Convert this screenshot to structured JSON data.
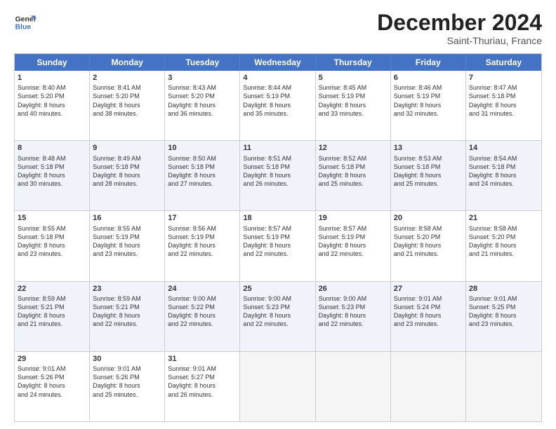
{
  "header": {
    "logo_line1": "General",
    "logo_line2": "Blue",
    "month": "December 2024",
    "location": "Saint-Thuriau, France"
  },
  "weekdays": [
    "Sunday",
    "Monday",
    "Tuesday",
    "Wednesday",
    "Thursday",
    "Friday",
    "Saturday"
  ],
  "rows": [
    [
      {
        "day": "1",
        "lines": [
          "Sunrise: 8:40 AM",
          "Sunset: 5:20 PM",
          "Daylight: 8 hours",
          "and 40 minutes."
        ]
      },
      {
        "day": "2",
        "lines": [
          "Sunrise: 8:41 AM",
          "Sunset: 5:20 PM",
          "Daylight: 8 hours",
          "and 38 minutes."
        ]
      },
      {
        "day": "3",
        "lines": [
          "Sunrise: 8:43 AM",
          "Sunset: 5:20 PM",
          "Daylight: 8 hours",
          "and 36 minutes."
        ]
      },
      {
        "day": "4",
        "lines": [
          "Sunrise: 8:44 AM",
          "Sunset: 5:19 PM",
          "Daylight: 8 hours",
          "and 35 minutes."
        ]
      },
      {
        "day": "5",
        "lines": [
          "Sunrise: 8:45 AM",
          "Sunset: 5:19 PM",
          "Daylight: 8 hours",
          "and 33 minutes."
        ]
      },
      {
        "day": "6",
        "lines": [
          "Sunrise: 8:46 AM",
          "Sunset: 5:19 PM",
          "Daylight: 8 hours",
          "and 32 minutes."
        ]
      },
      {
        "day": "7",
        "lines": [
          "Sunrise: 8:47 AM",
          "Sunset: 5:18 PM",
          "Daylight: 8 hours",
          "and 31 minutes."
        ]
      }
    ],
    [
      {
        "day": "8",
        "lines": [
          "Sunrise: 8:48 AM",
          "Sunset: 5:18 PM",
          "Daylight: 8 hours",
          "and 30 minutes."
        ]
      },
      {
        "day": "9",
        "lines": [
          "Sunrise: 8:49 AM",
          "Sunset: 5:18 PM",
          "Daylight: 8 hours",
          "and 28 minutes."
        ]
      },
      {
        "day": "10",
        "lines": [
          "Sunrise: 8:50 AM",
          "Sunset: 5:18 PM",
          "Daylight: 8 hours",
          "and 27 minutes."
        ]
      },
      {
        "day": "11",
        "lines": [
          "Sunrise: 8:51 AM",
          "Sunset: 5:18 PM",
          "Daylight: 8 hours",
          "and 26 minutes."
        ]
      },
      {
        "day": "12",
        "lines": [
          "Sunrise: 8:52 AM",
          "Sunset: 5:18 PM",
          "Daylight: 8 hours",
          "and 25 minutes."
        ]
      },
      {
        "day": "13",
        "lines": [
          "Sunrise: 8:53 AM",
          "Sunset: 5:18 PM",
          "Daylight: 8 hours",
          "and 25 minutes."
        ]
      },
      {
        "day": "14",
        "lines": [
          "Sunrise: 8:54 AM",
          "Sunset: 5:18 PM",
          "Daylight: 8 hours",
          "and 24 minutes."
        ]
      }
    ],
    [
      {
        "day": "15",
        "lines": [
          "Sunrise: 8:55 AM",
          "Sunset: 5:18 PM",
          "Daylight: 8 hours",
          "and 23 minutes."
        ]
      },
      {
        "day": "16",
        "lines": [
          "Sunrise: 8:55 AM",
          "Sunset: 5:19 PM",
          "Daylight: 8 hours",
          "and 23 minutes."
        ]
      },
      {
        "day": "17",
        "lines": [
          "Sunrise: 8:56 AM",
          "Sunset: 5:19 PM",
          "Daylight: 8 hours",
          "and 22 minutes."
        ]
      },
      {
        "day": "18",
        "lines": [
          "Sunrise: 8:57 AM",
          "Sunset: 5:19 PM",
          "Daylight: 8 hours",
          "and 22 minutes."
        ]
      },
      {
        "day": "19",
        "lines": [
          "Sunrise: 8:57 AM",
          "Sunset: 5:19 PM",
          "Daylight: 8 hours",
          "and 22 minutes."
        ]
      },
      {
        "day": "20",
        "lines": [
          "Sunrise: 8:58 AM",
          "Sunset: 5:20 PM",
          "Daylight: 8 hours",
          "and 21 minutes."
        ]
      },
      {
        "day": "21",
        "lines": [
          "Sunrise: 8:58 AM",
          "Sunset: 5:20 PM",
          "Daylight: 8 hours",
          "and 21 minutes."
        ]
      }
    ],
    [
      {
        "day": "22",
        "lines": [
          "Sunrise: 8:59 AM",
          "Sunset: 5:21 PM",
          "Daylight: 8 hours",
          "and 21 minutes."
        ]
      },
      {
        "day": "23",
        "lines": [
          "Sunrise: 8:59 AM",
          "Sunset: 5:21 PM",
          "Daylight: 8 hours",
          "and 22 minutes."
        ]
      },
      {
        "day": "24",
        "lines": [
          "Sunrise: 9:00 AM",
          "Sunset: 5:22 PM",
          "Daylight: 8 hours",
          "and 22 minutes."
        ]
      },
      {
        "day": "25",
        "lines": [
          "Sunrise: 9:00 AM",
          "Sunset: 5:23 PM",
          "Daylight: 8 hours",
          "and 22 minutes."
        ]
      },
      {
        "day": "26",
        "lines": [
          "Sunrise: 9:00 AM",
          "Sunset: 5:23 PM",
          "Daylight: 8 hours",
          "and 22 minutes."
        ]
      },
      {
        "day": "27",
        "lines": [
          "Sunrise: 9:01 AM",
          "Sunset: 5:24 PM",
          "Daylight: 8 hours",
          "and 23 minutes."
        ]
      },
      {
        "day": "28",
        "lines": [
          "Sunrise: 9:01 AM",
          "Sunset: 5:25 PM",
          "Daylight: 8 hours",
          "and 23 minutes."
        ]
      }
    ],
    [
      {
        "day": "29",
        "lines": [
          "Sunrise: 9:01 AM",
          "Sunset: 5:26 PM",
          "Daylight: 8 hours",
          "and 24 minutes."
        ]
      },
      {
        "day": "30",
        "lines": [
          "Sunrise: 9:01 AM",
          "Sunset: 5:26 PM",
          "Daylight: 8 hours",
          "and 25 minutes."
        ]
      },
      {
        "day": "31",
        "lines": [
          "Sunrise: 9:01 AM",
          "Sunset: 5:27 PM",
          "Daylight: 8 hours",
          "and 26 minutes."
        ]
      },
      {
        "day": "",
        "lines": []
      },
      {
        "day": "",
        "lines": []
      },
      {
        "day": "",
        "lines": []
      },
      {
        "day": "",
        "lines": []
      }
    ]
  ]
}
